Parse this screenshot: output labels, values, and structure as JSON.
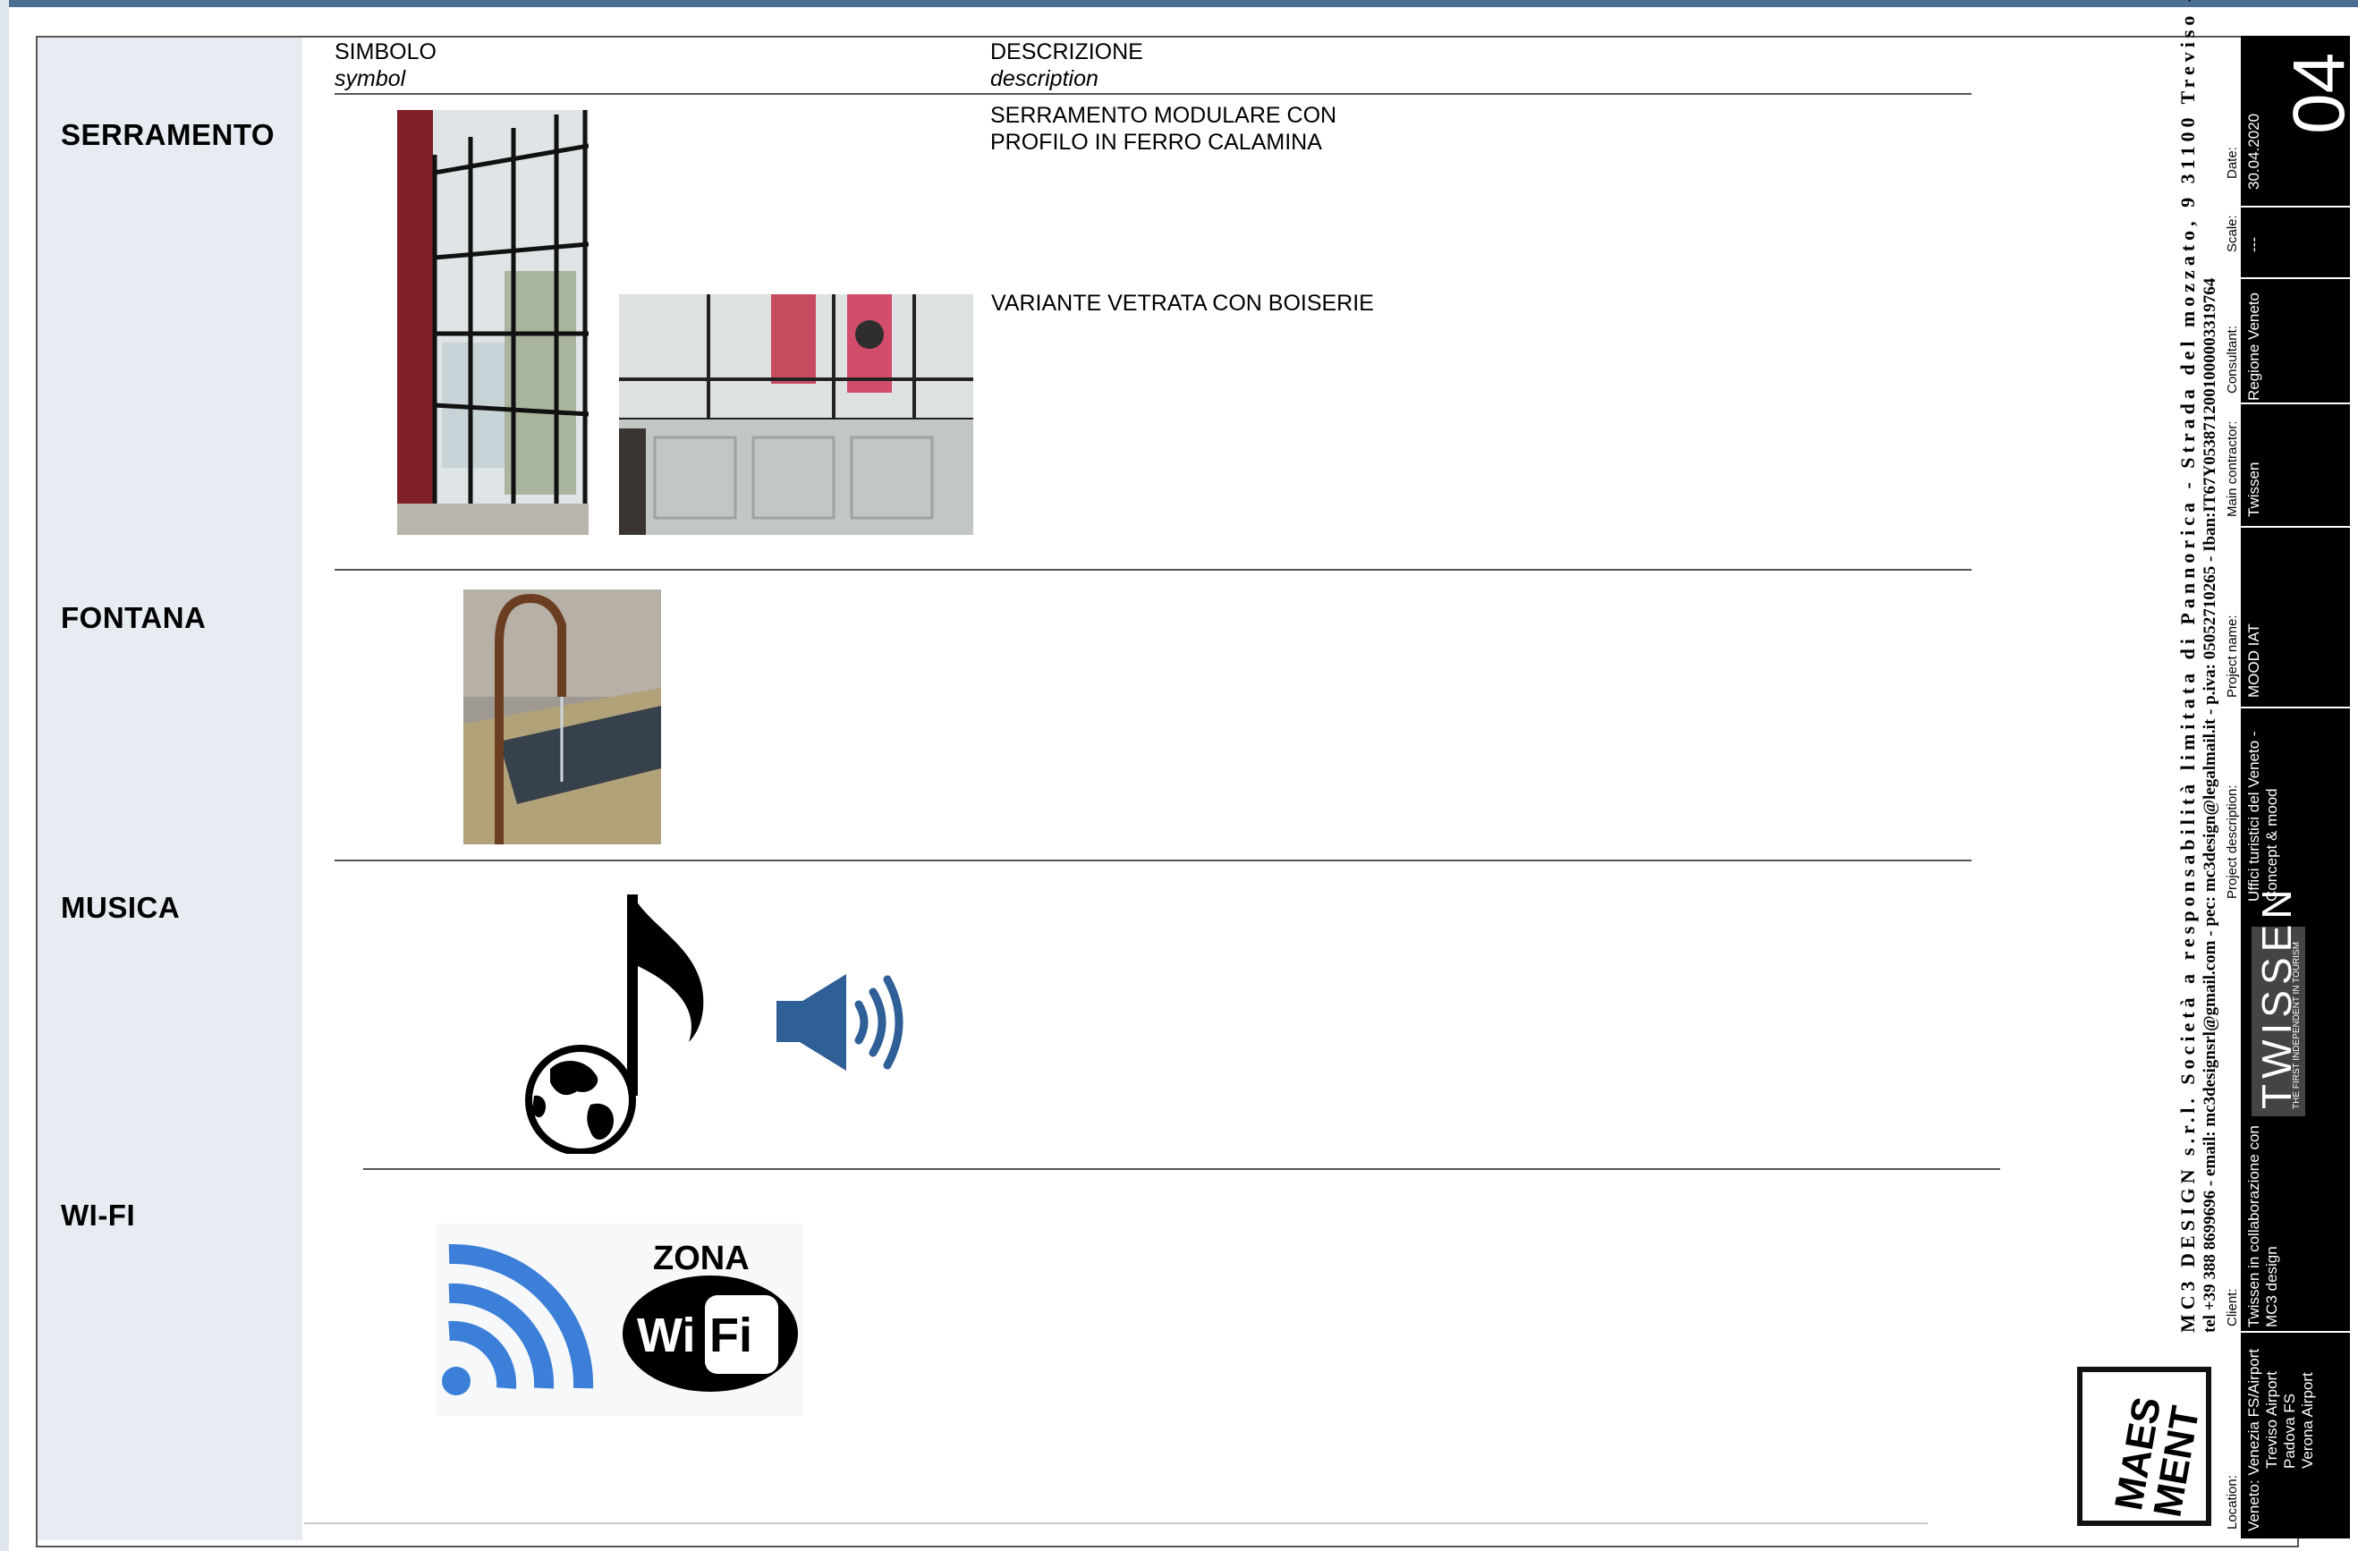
{
  "columns": {
    "symbol_it": "SIMBOLO",
    "symbol_en": "symbol",
    "description_it": "DESCRIZIONE",
    "description_en": "description"
  },
  "sections": [
    {
      "name": "SERRAMENTO",
      "descriptions": [
        "SERRAMENTO  MODULARE CON\nPROFILO IN FERRO CALAMINA",
        "VARIANTE VETRATA CON BOISERIE"
      ]
    },
    {
      "name": "FONTANA"
    },
    {
      "name": "MUSICA"
    },
    {
      "name": "WI-FI"
    }
  ],
  "wifi_sign": {
    "zona": "ZONA",
    "wi": "Wi",
    "fi": "Fi"
  },
  "company": {
    "line1": "MC3 DESIGN s.r.l. Società a responsabilità limitata di Pannorica - Strada del mozzato, 9 31100 Treviso -",
    "line2": "tel +39 388 8699696 - email: mc3designsrl@gmail.com - pec: mc3design@legalmail.it - p.iva: 05052710265 - Iban:IT67Y0538712001000003319764"
  },
  "title_block": {
    "sheet_number": "04",
    "date_label": "Date:",
    "date_value": "30.04.2020",
    "scale_label": "Scale:",
    "scale_value": "---",
    "consultant_label": "Consultant:",
    "consultant_value": "Regione Veneto",
    "main_contractor_label": "Main contractor:",
    "main_contractor_value": "Twissen",
    "project_name_label": "Project name:",
    "project_name_value": "MOOD IAT",
    "project_description_label": "Project description:",
    "project_description_value": [
      "Uffici turistici del Veneto -",
      "Concept & mood"
    ],
    "twissen_logo": "TWISSEN",
    "twissen_tagline": "THE FIRST INDEPENDENT IN TOURISM",
    "client_label": "Client:",
    "client_value": [
      "Twissen in collaborazione con",
      "MC3 design"
    ],
    "location_label": "Location:",
    "location_value": [
      "Veneto:  Venezia FS/Airport",
      "Treviso Airport",
      "Padova FS",
      "Verona Airport"
    ],
    "logo_text": [
      "MAES",
      "MENT"
    ]
  },
  "colors": {
    "left_column": "#e7ecf3",
    "frame": "#4b6d92",
    "speaker_blue": "#2f5f97",
    "wifi_blue": "#3b7fd8"
  }
}
